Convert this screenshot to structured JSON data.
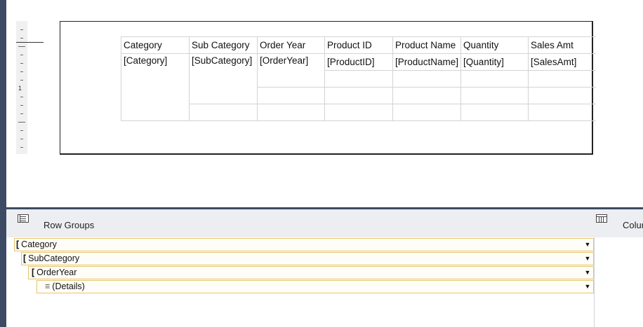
{
  "tablix": {
    "headers": [
      "Category",
      "Sub Category",
      "Order Year",
      "Product ID",
      "Product Name",
      "Quantity",
      "Sales Amt"
    ],
    "row1": [
      "[Category]",
      "[SubCategory]",
      "[OrderYear]",
      "[ProductID]",
      "[ProductName]",
      "[Quantity]",
      "[SalesAmt]"
    ]
  },
  "grouping_pane": {
    "row_groups_title": "Row Groups",
    "column_groups_title": "Colur",
    "row_groups": [
      {
        "label": "Category",
        "icon": "group-bracket-icon"
      },
      {
        "label": "SubCategory",
        "icon": "group-bracket-icon"
      },
      {
        "label": "OrderYear",
        "icon": "group-bracket-icon"
      },
      {
        "label": "(Details)",
        "icon": "details-icon"
      }
    ]
  },
  "ruler": {
    "mark": "1"
  },
  "colors": {
    "accent_dark": "#3c4a63",
    "group_border": "#e6c46a",
    "pane_bg": "#eceef1"
  }
}
